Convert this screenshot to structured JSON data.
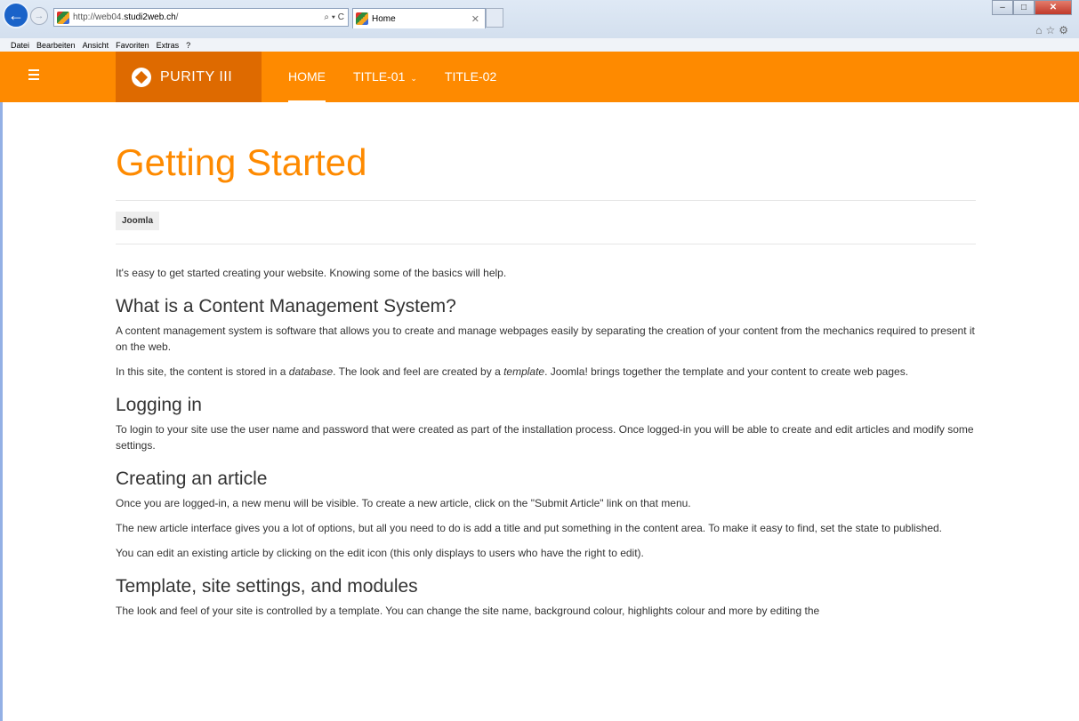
{
  "browser": {
    "url_prefix": "http://web04.",
    "url_domain": "studi2web.ch",
    "url_suffix": "/",
    "address_controls": "⌕ ▾ C",
    "tab_title": "Home",
    "menubar": [
      "Datei",
      "Bearbeiten",
      "Ansicht",
      "Favoriten",
      "Extras",
      "?"
    ]
  },
  "site": {
    "logo_text": "PURITY III",
    "nav": [
      {
        "label": "HOME"
      },
      {
        "label": "TITLE-01"
      },
      {
        "label": "TITLE-02"
      }
    ],
    "brand_color": "#fe8a00",
    "logo_bg_color": "#de6a00"
  },
  "article": {
    "title": "Getting Started",
    "tag": "Joomla",
    "intro": "It's easy to get started creating your website. Knowing some of the basics will help.",
    "sections": [
      {
        "heading": "What is a Content Management System?",
        "p1": "A content management system is software that allows you to create and manage webpages easily by separating the creation of your content from the mechanics required to present it on the web.",
        "p2_a": "In this site, the content is stored in a ",
        "p2_b": "database",
        "p2_c": ". The look and feel are created by a ",
        "p2_d": "template",
        "p2_e": ". Joomla! brings together the template and your content to create web pages."
      },
      {
        "heading": "Logging in",
        "p1": "To login to your site use the user name and password that were created as part of the installation process. Once logged-in you will be able to create and edit articles and modify some settings."
      },
      {
        "heading": "Creating an article",
        "p1": "Once you are logged-in, a new menu will be visible. To create a new article, click on the \"Submit Article\" link on that menu.",
        "p2": "The new article interface gives you a lot of options, but all you need to do is add a title and put something in the content area. To make it easy to find, set the state to published.",
        "p3": "You can edit an existing article by clicking on the edit icon (this only displays to users who have the right to edit)."
      },
      {
        "heading": "Template, site settings, and modules",
        "p1": "The look and feel of your site is controlled by a template. You can change the site name, background colour, highlights colour and more by editing the"
      }
    ]
  }
}
